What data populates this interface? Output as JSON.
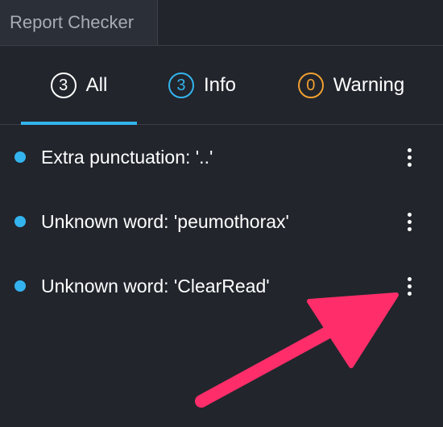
{
  "panel": {
    "tab_label": "Report Checker"
  },
  "filters": [
    {
      "count": "3",
      "label": "All",
      "color": "#ffffff",
      "active": true
    },
    {
      "count": "3",
      "label": "Info",
      "color": "#33b4ee",
      "active": false
    },
    {
      "count": "0",
      "label": "Warning",
      "color": "#f0a030",
      "active": false
    }
  ],
  "issues": [
    {
      "text": "Extra punctuation: '..'",
      "severity": "info",
      "menu_icon": "more-vertical-icon"
    },
    {
      "text": "Unknown word: 'peumothorax'",
      "severity": "info",
      "menu_icon": "more-vertical-icon"
    },
    {
      "text": "Unknown word: 'ClearRead'",
      "severity": "info",
      "menu_icon": "more-vertical-icon"
    }
  ],
  "colors": {
    "background": "#22252c",
    "accent": "#33b4ee",
    "warning": "#f0a030",
    "annotation_arrow": "#ff2e6a"
  }
}
